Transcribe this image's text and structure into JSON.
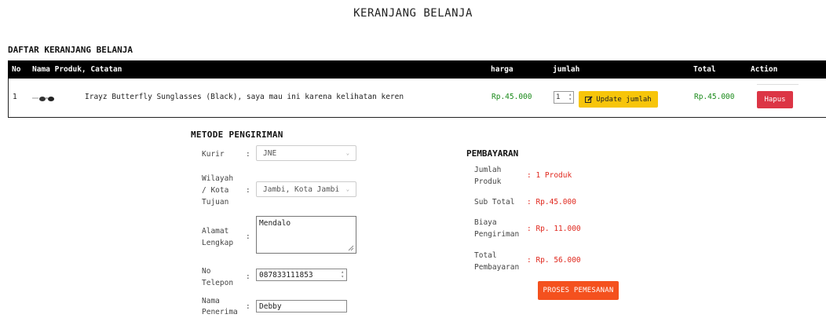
{
  "page": {
    "title": "KERANJANG BELANJA"
  },
  "cart": {
    "title": "DAFTAR KERANJANG BELANJA",
    "columns": {
      "no": "No",
      "product": "Nama Produk, Catatan",
      "price": "harga",
      "qty": "jumlah",
      "total": "Total",
      "action": "Action"
    },
    "rows": [
      {
        "no": "1",
        "product_image": "sunglasses-image",
        "product_text": "Irayz Butterfly Sunglasses (Black), saya mau ini karena kelihatan keren",
        "price": "Rp.45.000",
        "qty": "1",
        "update_label": "Update jumlah",
        "total": "Rp.45.000",
        "delete_label": "Hapus"
      }
    ]
  },
  "shipping": {
    "title": "METODE PENGIRIMAN",
    "courier_label": "Kurir",
    "courier_value": "JNE",
    "region_label_1": "Wilayah",
    "region_label_2": "/ Kota",
    "region_label_3": "Tujuan",
    "region_value": "Jambi, Kota Jambi",
    "address_label_1": "Alamat",
    "address_label_2": "Lengkap",
    "address_value": "Mendalo",
    "phone_label_1": "No",
    "phone_label_2": "Telepon",
    "phone_value": "087833111853",
    "recipient_label_1": "Nama",
    "recipient_label_2": "Penerima",
    "recipient_value": "Debby",
    "colon": ":"
  },
  "payment": {
    "title": "PEMBAYARAN",
    "qty_label_1": "Jumlah",
    "qty_label_2": "Produk",
    "qty_value": ": 1 Produk",
    "subtotal_label": "Sub Total",
    "subtotal_value": ": Rp.45.000",
    "shipping_label_1": "Biaya",
    "shipping_label_2": "Pengiriman",
    "shipping_value": ": Rp. 11.000",
    "total_label_1": "Total",
    "total_label_2": "Pembayaran",
    "total_value": ": Rp. 56.000",
    "order_button": "PROSES PEMESANAN"
  },
  "colors": {
    "header_bg": "#000000",
    "price_green": "#1a8a1a",
    "update_yellow": "#f7c50a",
    "delete_red": "#dc3545",
    "payment_red": "#e0281e",
    "order_orange": "#f4511e"
  }
}
